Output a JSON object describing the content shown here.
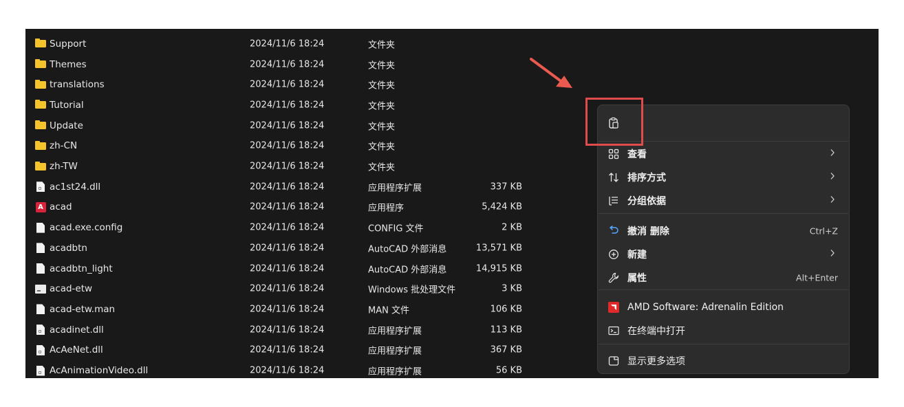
{
  "files": [
    {
      "name": "Support",
      "date": "2024/11/6 18:24",
      "type": "文件夹",
      "size": "",
      "icon": "folder-icon"
    },
    {
      "name": "Themes",
      "date": "2024/11/6 18:24",
      "type": "文件夹",
      "size": "",
      "icon": "folder-icon"
    },
    {
      "name": "translations",
      "date": "2024/11/6 18:24",
      "type": "文件夹",
      "size": "",
      "icon": "folder-icon"
    },
    {
      "name": "Tutorial",
      "date": "2024/11/6 18:24",
      "type": "文件夹",
      "size": "",
      "icon": "folder-icon"
    },
    {
      "name": "Update",
      "date": "2024/11/6 18:24",
      "type": "文件夹",
      "size": "",
      "icon": "folder-icon"
    },
    {
      "name": "zh-CN",
      "date": "2024/11/6 18:24",
      "type": "文件夹",
      "size": "",
      "icon": "folder-icon"
    },
    {
      "name": "zh-TW",
      "date": "2024/11/6 18:24",
      "type": "文件夹",
      "size": "",
      "icon": "folder-icon"
    },
    {
      "name": "ac1st24.dll",
      "date": "2024/11/6 18:24",
      "type": "应用程序扩展",
      "size": "337 KB",
      "icon": "dll-file-icon"
    },
    {
      "name": "acad",
      "date": "2024/11/6 18:24",
      "type": "应用程序",
      "size": "5,424 KB",
      "icon": "autocad-app-icon"
    },
    {
      "name": "acad.exe.config",
      "date": "2024/11/6 18:24",
      "type": "CONFIG 文件",
      "size": "2 KB",
      "icon": "document-icon"
    },
    {
      "name": "acadbtn",
      "date": "2024/11/6 18:24",
      "type": "AutoCAD 外部消息",
      "size": "13,571 KB",
      "icon": "document-icon"
    },
    {
      "name": "acadbtn_light",
      "date": "2024/11/6 18:24",
      "type": "AutoCAD 外部消息",
      "size": "14,915 KB",
      "icon": "document-icon"
    },
    {
      "name": "acad-etw",
      "date": "2024/11/6 18:24",
      "type": "Windows 批处理文件",
      "size": "3 KB",
      "icon": "batch-file-icon"
    },
    {
      "name": "acad-etw.man",
      "date": "2024/11/6 18:24",
      "type": "MAN 文件",
      "size": "106 KB",
      "icon": "document-icon"
    },
    {
      "name": "acadinet.dll",
      "date": "2024/11/6 18:24",
      "type": "应用程序扩展",
      "size": "113 KB",
      "icon": "dll-file-icon"
    },
    {
      "name": "AcAeNet.dll",
      "date": "2024/11/6 18:24",
      "type": "应用程序扩展",
      "size": "367 KB",
      "icon": "dll-file-icon"
    },
    {
      "name": "AcAnimationVideo.dll",
      "date": "2024/11/6 18:24",
      "type": "应用程序扩展",
      "size": "56 KB",
      "icon": "dll-file-icon"
    }
  ],
  "context_menu": {
    "paste_icon": "paste-icon",
    "items": [
      {
        "label": "查看",
        "icon": "view-grid-icon",
        "shortcut": "",
        "submenu": true
      },
      {
        "label": "排序方式",
        "icon": "sort-icon",
        "shortcut": "",
        "submenu": true
      },
      {
        "label": "分组依据",
        "icon": "group-by-icon",
        "shortcut": "",
        "submenu": true
      },
      {
        "label": "撤消 删除",
        "icon": "undo-icon",
        "shortcut": "Ctrl+Z",
        "submenu": false
      },
      {
        "label": "新建",
        "icon": "new-plus-icon",
        "shortcut": "",
        "submenu": true
      },
      {
        "label": "属性",
        "icon": "properties-wrench-icon",
        "shortcut": "Alt+Enter",
        "submenu": false
      },
      {
        "label": "AMD Software: Adrenalin Edition",
        "icon": "amd-logo-icon",
        "shortcut": "",
        "submenu": false
      },
      {
        "label": "在终端中打开",
        "icon": "terminal-icon",
        "shortcut": "",
        "submenu": false
      },
      {
        "label": "显示更多选项",
        "icon": "more-options-icon",
        "shortcut": "",
        "submenu": false
      }
    ]
  },
  "colors": {
    "explorer_bg": "#191919",
    "menu_bg": "#2c2c2c",
    "highlight": "#e04b4b",
    "folder": "#f5c32b",
    "amd_red": "#e02a2a"
  }
}
